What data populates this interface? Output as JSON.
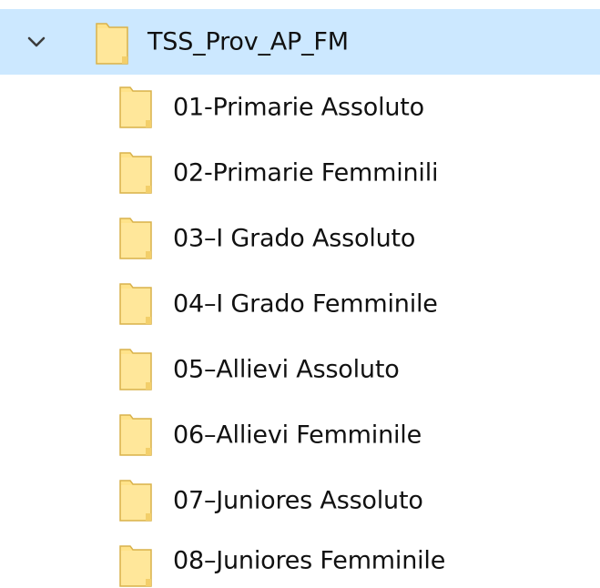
{
  "tree": {
    "root": {
      "label": "TSS_Prov_AP_FM",
      "expanded": true,
      "selected": true,
      "icon": "folder-icon",
      "toggle_icon": "chevron-down-icon"
    },
    "children": [
      {
        "label": "01-Primarie Assoluto",
        "icon": "folder-icon"
      },
      {
        "label": "02-Primarie Femminili",
        "icon": "folder-icon"
      },
      {
        "label": "03–I Grado Assoluto",
        "icon": "folder-icon"
      },
      {
        "label": "04–I Grado Femminile",
        "icon": "folder-icon"
      },
      {
        "label": "05–Allievi Assoluto",
        "icon": "folder-icon"
      },
      {
        "label": "06–Allievi Femminile",
        "icon": "folder-icon"
      },
      {
        "label": "07–Juniores Assoluto",
        "icon": "folder-icon"
      },
      {
        "label": "08–Juniores Femminile",
        "icon": "folder-icon"
      }
    ]
  },
  "colors": {
    "selection_background": "#cce8ff",
    "folder_fill": "#ffe38a",
    "folder_stroke": "#d9b24c",
    "chevron": "#3c3c3c",
    "text": "#111111"
  }
}
